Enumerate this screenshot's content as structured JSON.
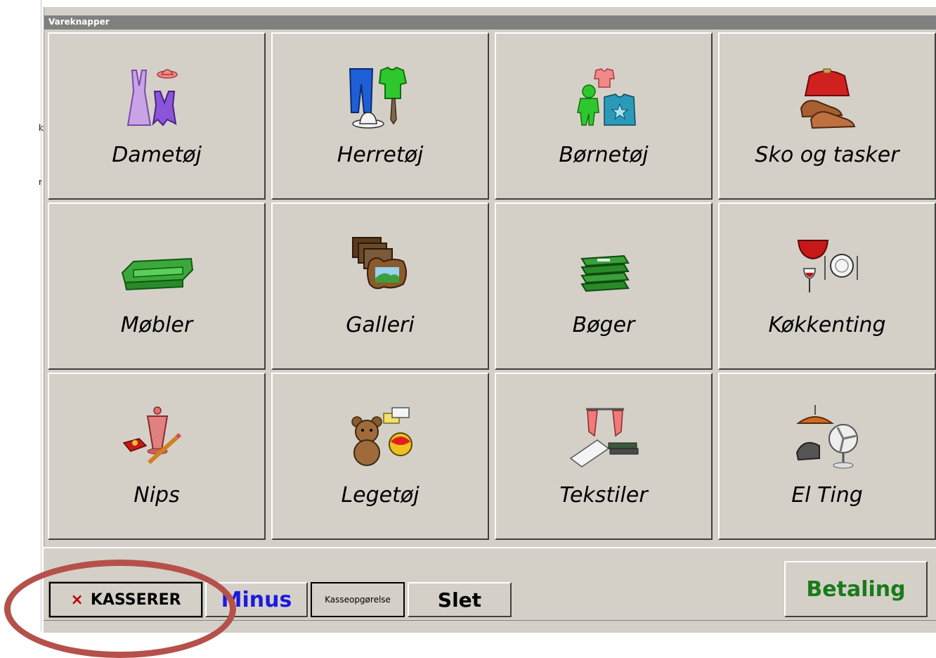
{
  "window": {
    "title": "Vareknapper"
  },
  "left_strip": {
    "chars": [
      "k",
      "r"
    ]
  },
  "tiles": [
    {
      "label": "Dametøj",
      "icon": "womens-clothing-icon"
    },
    {
      "label": "Herretøj",
      "icon": "mens-clothing-icon"
    },
    {
      "label": "Børnetøj",
      "icon": "kids-clothing-icon"
    },
    {
      "label": "Sko og tasker",
      "icon": "shoes-bag-icon"
    },
    {
      "label": "Møbler",
      "icon": "sofa-icon"
    },
    {
      "label": "Galleri",
      "icon": "picture-frames-icon"
    },
    {
      "label": "Bøger",
      "icon": "books-icon"
    },
    {
      "label": "Køkkenting",
      "icon": "kitchenware-icon"
    },
    {
      "label": "Nips",
      "icon": "trinkets-icon"
    },
    {
      "label": "Legetøj",
      "icon": "toys-icon"
    },
    {
      "label": "Tekstiler",
      "icon": "textiles-icon"
    },
    {
      "label": "El Ting",
      "icon": "electrics-icon"
    }
  ],
  "buttons": {
    "kasserer": "KASSERER",
    "kasserer_mark": "×",
    "minus": "Minus",
    "kasseopgorelse": "Kasseopgørelse",
    "slet": "Slet",
    "betaling": "Betaling"
  },
  "colors": {
    "panel": "#d4d0c8",
    "titlebar": "#808080",
    "minus_text": "#1a1ae0",
    "betaling_text": "#1a7a1a",
    "annotation": "#b5504b"
  }
}
